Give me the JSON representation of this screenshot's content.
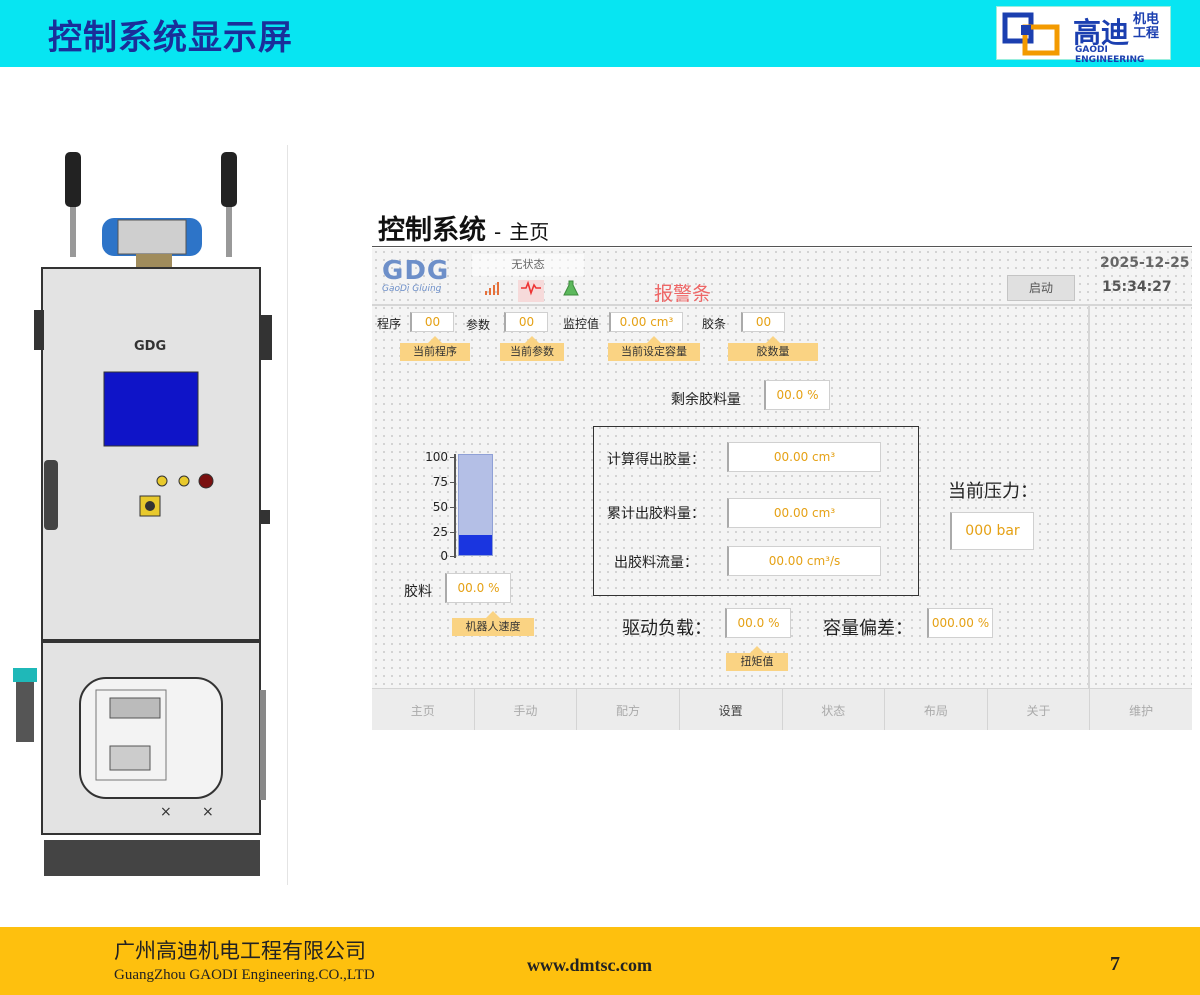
{
  "slide": {
    "title": "控制系统显示屏",
    "page_number": "7"
  },
  "brand": {
    "name_cn": "高迪",
    "name_cn_small": "机电工程",
    "name_en": "GAODI ENGINEERING"
  },
  "footer": {
    "company_cn": "广州高迪机电工程有限公司",
    "company_en": "GuangZhou GAODI Engineering.CO.,LTD",
    "website": "www.dmtsc.com"
  },
  "ui": {
    "title": "控制系统",
    "dash": "-",
    "subtitle": "主页",
    "logo_text": "GDG",
    "logo_sub": "GaoDi Gluing",
    "status_text": "无状态",
    "alarm_bar": "报警条",
    "start_button": "启动",
    "date": "2025-12-25",
    "time": "15:34:27",
    "colors": {
      "value_text": "#e5a115",
      "tag_bg": "#fad383",
      "gauge_fill": "#1a35e0",
      "alarm_text": "#e66666"
    },
    "fields": {
      "program_label": "程序",
      "program_value": "00",
      "program_tag": "当前程序",
      "param_label": "参数",
      "param_value": "00",
      "param_tag": "当前参数",
      "monitor_label": "监控值",
      "monitor_value": "0.00 cm³",
      "monitor_tag": "当前设定容量",
      "strip_label": "胶条",
      "strip_value": "00",
      "strip_tag": "胶数量",
      "remaining_label": "剩余胶料量",
      "remaining_value": "00.0 %",
      "calc_label": "计算得出胶量：",
      "calc_value": "00.00  cm³",
      "cumulative_label": "累计出胶料量：",
      "cumulative_value": "00.00  cm³",
      "flow_label": "出胶料流量：",
      "flow_value": "00.00 cm³/s",
      "pressure_label": "当前压力：",
      "pressure_value": "000 bar",
      "glue_label": "胶料",
      "glue_value": "00.0 %",
      "glue_tag": "机器人速度",
      "drive_label": "驱动负载：",
      "drive_value": "00.0 %",
      "drive_tag": "扭矩值",
      "deviation_label": "容量偏差：",
      "deviation_value": "000.00 %"
    },
    "gauge": {
      "ticks": [
        "100",
        "75",
        "50",
        "25",
        "0"
      ],
      "level": 20
    },
    "tabs": [
      "主页",
      "手动",
      "配方",
      "设置",
      "状态",
      "布局",
      "关于",
      "维护"
    ],
    "active_tab": "设置",
    "status_icons": [
      "signal-icon",
      "waveform-icon",
      "flask-icon"
    ]
  }
}
